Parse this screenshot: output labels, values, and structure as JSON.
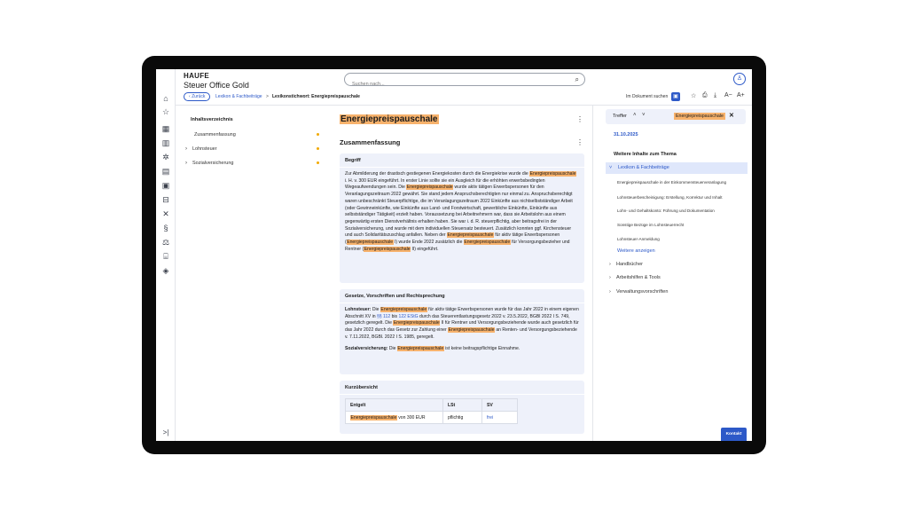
{
  "app": {
    "brand": "HAUFE",
    "product": "Steuer Office Gold"
  },
  "search": {
    "placeholder": "Suchen nach..."
  },
  "nav": {
    "back_label": "Zurück",
    "breadcrumb": [
      "Lexikon & Fachbeiträge",
      "Lexikonstichwort: Energiepreispauschale"
    ],
    "separator": ">"
  },
  "toolbar": {
    "search_in_doc": "Im Dokument suchen"
  },
  "icons": {
    "rail": [
      "home-icon",
      "star-icon",
      "calculator-icon",
      "book-open-icon",
      "network-icon",
      "news-icon",
      "book-icon",
      "toolbox-icon",
      "tools-icon",
      "paragraph-icon",
      "scale-icon",
      "bank-icon",
      "graduation-icon"
    ],
    "collapse": "expand-sidebar-icon"
  },
  "toc": {
    "title": "Inhaltsverzeichnis",
    "items": [
      {
        "label": "Zusammenfassung",
        "expandable": false
      },
      {
        "label": "Lohnsteuer",
        "expandable": true
      },
      {
        "label": "Sozialversicherung",
        "expandable": true
      }
    ]
  },
  "article": {
    "title": "Energiepreispauschale",
    "section": "Zusammenfassung",
    "begriff": {
      "heading": "Begriff",
      "p1": "Zur Abmilderung der drastisch gestiegenen Energiekosten durch die Energiekrise wurde die ",
      "hl": "Energiepreispauschale",
      "p2": " i. H. v. 300 EUR eingeführt. In erster Linie sollte sie ein Ausgleich für die erhöhten erwerbsbedingten Wegeaufwendungen sein. Die ",
      "p3": " wurde aktiv tätigen Erwerbspersonen für den Veranlagungszeitraum 2022 gewährt. Sie stand jedem Anspruchsberechtigten nur einmal zu. Anspruchsberechtigt waren unbeschränkt Steuerpflichtige, die im Veranlagungszeitraum 2022 Einkünfte aus nichtselbstständiger Arbeit (oder Gewinneinkünfte, wie Einkünfte aus Land- und Forstwirtschaft, gewerbliche Einkünfte, Einkünfte aus selbstständiger Tätigkeit) erzielt haben. Voraussetzung bei Arbeitnehmern war, dass sie Arbeitslohn aus einem gegenwärtig ersten Dienstverhältnis erhalten haben. Sie war i. d. R. steuerpflichtig, aber beitragsfrei in der Sozialversicherung, und wurde mit dem individuellen Steuersatz besteuert. Zusätzlich konnten ggf. Kirchensteuer und auch Solidaritätszuschlag anfallen. Neben der ",
      "p4": " für aktiv tätige Erwerbspersonen (",
      "p5": " I) wurde Ende 2022 zusätzlich die ",
      "p6": " für Versorgungsbezieher und Rentner (",
      "p7": " II) eingeführt."
    },
    "gesetze": {
      "heading": "Gesetze, Vorschriften und Rechtsprechung",
      "ls_label": "Lohnsteuer:",
      "ls1": " Die ",
      "ls2": " für aktiv tätige Erwerbspersonen wurde für das Jahr 2022 in einem eigenen Abschnitt XV in ",
      "link1": "§§ 112",
      "ls3": " bis ",
      "link2": "122 EStG",
      "ls4": " durch das Steuerentlastungsgesetz 2022 v. 23.5.2022, BGBl 2022 I S. 749, gesetzlich geregelt. Die ",
      "ls5": " II für Rentner und Versorgungsbeziehende wurde auch gesetzlich für das Jahr 2022 durch das Gesetz zur Zahlung einer ",
      "ls6": " an Renten- und Versorgungsbeziehende v. 7.11.2022, BGBl. 2022 I S. 1985, geregelt.",
      "sv_label": "Sozialversicherung:",
      "sv1": " Die ",
      "sv2": " ist keine beitragspflichtige Einnahme."
    },
    "kurz": {
      "heading": "Kurzübersicht",
      "columns": [
        "Entgelt",
        "LSt",
        "SV"
      ],
      "row": {
        "hl": "Energiepreispauschale",
        "entgelt_rest": " von 300 EUR",
        "lst": "pflichtig",
        "sv": "frei"
      }
    }
  },
  "right_panel": {
    "hits_label": "Treffer",
    "hit_chip": "Energiepreispauschale",
    "date": "31.10.2025",
    "more_title": "Weitere Inhalte zum Thema",
    "selected_category": "Lexikon & Fachbeiträge",
    "links": [
      "Energiepreispauschale in der Einkommensteuerveranlagung",
      "Lohnsteuerbescheinigung: Erstellung, Korrektur und Inhalt",
      "Lohn- und Gehaltskonto: Führung und Dokumentation",
      "Sonstige Bezüge im Lohnsteuerrecht",
      "Lohnsteuer-Anmeldung"
    ],
    "show_more": "Weitere anzeigen",
    "categories": [
      "Handbücher",
      "Arbeitshilfen & Tools",
      "Verwaltungsvorschriften"
    ]
  },
  "contact": {
    "label": "Kontakt"
  },
  "colors": {
    "accent": "#2d59c8",
    "highlight": "#f7b26c",
    "box_bg": "#eef1fa",
    "dot": "#f2a900"
  }
}
